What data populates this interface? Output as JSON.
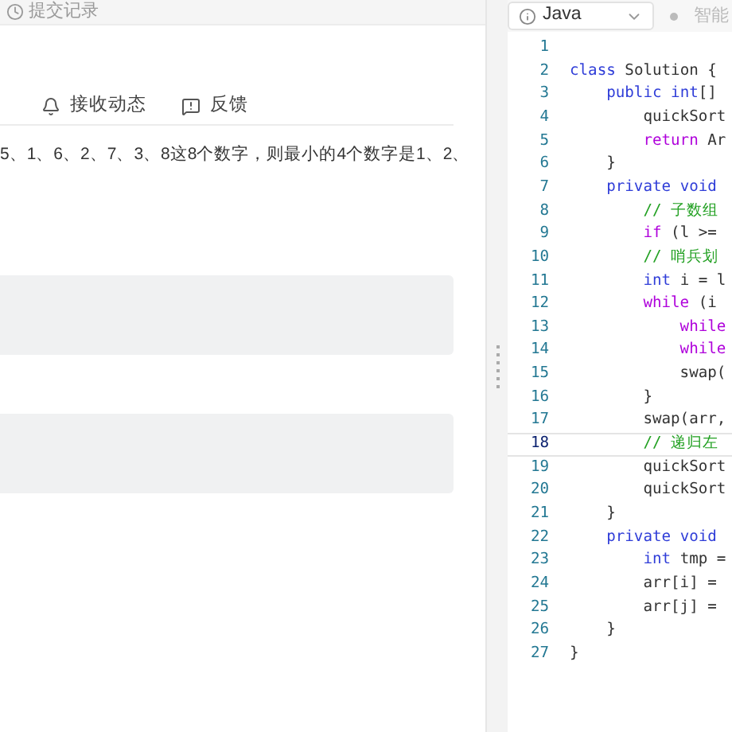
{
  "top_bar": {
    "submissions_link": "提交记录"
  },
  "problem_tabs": [
    {
      "label": "接收动态"
    },
    {
      "label": "反馈"
    }
  ],
  "description": "5、1、6、2、7、3、8这8个数字，则最小的4个数字是1、2、",
  "editor_toolbar": {
    "language": "Java",
    "assistant_label": "智能"
  },
  "code_lines": [
    {
      "number": "1",
      "selected": false
    },
    {
      "number": "2",
      "selected": false,
      "tokens": [
        {
          "kind": "keyword",
          "text": "class"
        },
        {
          "kind": "plain",
          "text": " Solution {"
        }
      ]
    },
    {
      "number": "3",
      "selected": false,
      "tokens": [
        {
          "kind": "keyword",
          "text": "    public"
        },
        {
          "kind": "type",
          "text": " int"
        },
        {
          "kind": "plain",
          "text": "[]"
        }
      ]
    },
    {
      "number": "4",
      "selected": false,
      "tokens": [
        {
          "kind": "plain",
          "text": "        quickSort"
        }
      ]
    },
    {
      "number": "5",
      "selected": false,
      "tokens": [
        {
          "kind": "control",
          "text": "        return"
        },
        {
          "kind": "plain",
          "text": " Ar"
        }
      ]
    },
    {
      "number": "6",
      "selected": false,
      "tokens": [
        {
          "kind": "plain",
          "text": "    }"
        }
      ]
    },
    {
      "number": "7",
      "selected": false,
      "tokens": [
        {
          "kind": "keyword",
          "text": "    private"
        },
        {
          "kind": "type",
          "text": " void"
        }
      ]
    },
    {
      "number": "8",
      "selected": false,
      "tokens": [
        {
          "kind": "comment",
          "text": "        // 子数组"
        }
      ]
    },
    {
      "number": "9",
      "selected": false,
      "tokens": [
        {
          "kind": "control",
          "text": "        if"
        },
        {
          "kind": "plain",
          "text": " (l >="
        }
      ]
    },
    {
      "number": "10",
      "selected": false,
      "tokens": [
        {
          "kind": "comment",
          "text": "        // 哨兵划"
        }
      ]
    },
    {
      "number": "11",
      "selected": false,
      "tokens": [
        {
          "kind": "type",
          "text": "        int"
        },
        {
          "kind": "plain",
          "text": " i = l"
        }
      ]
    },
    {
      "number": "12",
      "selected": false,
      "tokens": [
        {
          "kind": "control",
          "text": "        while"
        },
        {
          "kind": "plain",
          "text": " (i"
        }
      ]
    },
    {
      "number": "13",
      "selected": false,
      "tokens": [
        {
          "kind": "control",
          "text": "            while"
        }
      ]
    },
    {
      "number": "14",
      "selected": false,
      "tokens": [
        {
          "kind": "control",
          "text": "            while"
        }
      ]
    },
    {
      "number": "15",
      "selected": false,
      "tokens": [
        {
          "kind": "plain",
          "text": "            swap("
        }
      ]
    },
    {
      "number": "16",
      "selected": false,
      "tokens": [
        {
          "kind": "plain",
          "text": "        }"
        }
      ]
    },
    {
      "number": "17",
      "selected": false,
      "tokens": [
        {
          "kind": "plain",
          "text": "        swap(arr,"
        }
      ]
    },
    {
      "number": "18",
      "selected": true,
      "tokens": [
        {
          "kind": "comment",
          "text": "        // 递归左"
        }
      ]
    },
    {
      "number": "19",
      "selected": false,
      "tokens": [
        {
          "kind": "plain",
          "text": "        quickSort"
        }
      ]
    },
    {
      "number": "20",
      "selected": false,
      "tokens": [
        {
          "kind": "plain",
          "text": "        quickSort"
        }
      ]
    },
    {
      "number": "21",
      "selected": false,
      "tokens": [
        {
          "kind": "plain",
          "text": "    }"
        }
      ]
    },
    {
      "number": "22",
      "selected": false,
      "tokens": [
        {
          "kind": "keyword",
          "text": "    private"
        },
        {
          "kind": "type",
          "text": " void"
        }
      ]
    },
    {
      "number": "23",
      "selected": false,
      "tokens": [
        {
          "kind": "type",
          "text": "        int"
        },
        {
          "kind": "plain",
          "text": " tmp ="
        }
      ]
    },
    {
      "number": "24",
      "selected": false,
      "tokens": [
        {
          "kind": "plain",
          "text": "        arr[i] ="
        }
      ]
    },
    {
      "number": "25",
      "selected": false,
      "tokens": [
        {
          "kind": "plain",
          "text": "        arr[j] ="
        }
      ]
    },
    {
      "number": "26",
      "selected": false,
      "tokens": [
        {
          "kind": "plain",
          "text": "    }"
        }
      ]
    },
    {
      "number": "27",
      "selected": false,
      "tokens": [
        {
          "kind": "plain",
          "text": "}"
        }
      ]
    }
  ]
}
